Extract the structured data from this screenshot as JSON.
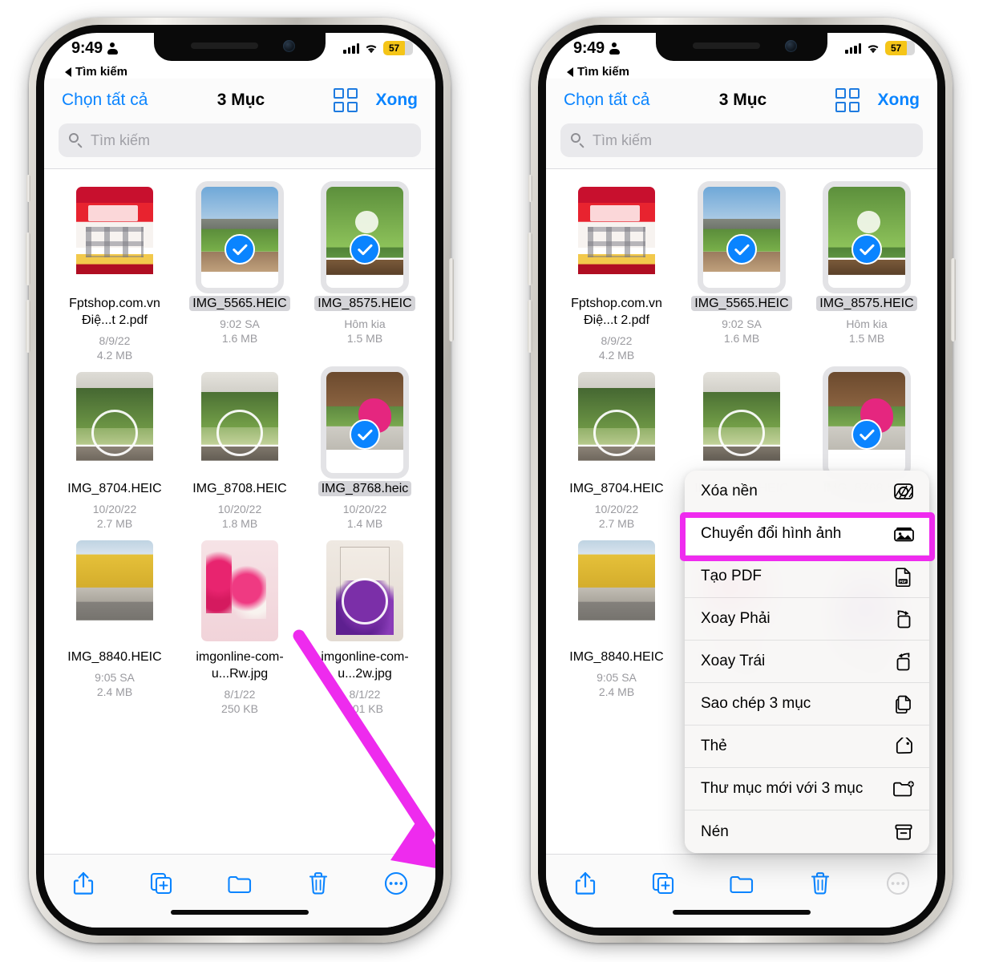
{
  "status_bar": {
    "time": "9:49",
    "battery_percent": "57",
    "back_label": "Tìm kiếm"
  },
  "nav": {
    "select_all": "Chọn tất cả",
    "title": "3 Mục",
    "done": "Xong"
  },
  "search": {
    "placeholder": "Tìm kiếm"
  },
  "files": [
    {
      "name": "Fptshop.com.vn  Điệ...t 2.pdf",
      "date": "8/9/22",
      "size": "4.2 MB",
      "selected": false,
      "art": "t-pdf",
      "focus_ring": false
    },
    {
      "name": "IMG_5565.HEIC",
      "date": "9:02 SA",
      "size": "1.6 MB",
      "selected": true,
      "art": "t-plant1",
      "focus_ring": false
    },
    {
      "name": "IMG_8575.HEIC",
      "date": "Hôm kia",
      "size": "1.5 MB",
      "selected": true,
      "art": "t-leaf",
      "focus_ring": false
    },
    {
      "name": "IMG_8704.HEIC",
      "date": "10/20/22",
      "size": "2.7 MB",
      "selected": false,
      "art": "t-garden",
      "focus_ring": true
    },
    {
      "name": "IMG_8708.HEIC",
      "date": "10/20/22",
      "size": "1.8 MB",
      "selected": false,
      "art": "t-garden2",
      "focus_ring": true
    },
    {
      "name": "IMG_8768.heic",
      "date": "10/20/22",
      "size": "1.4 MB",
      "selected": true,
      "art": "t-pink",
      "focus_ring": false
    },
    {
      "name": "IMG_8840.HEIC",
      "date": "9:05 SA",
      "size": "2.4 MB",
      "selected": false,
      "art": "t-street",
      "focus_ring": false
    },
    {
      "name": "imgonline-com-u...Rw.jpg",
      "date": "8/1/22",
      "size": "250 KB",
      "selected": false,
      "art": "t-rose",
      "focus_ring": false
    },
    {
      "name": "imgonline-com-u...2w.jpg",
      "date": "8/1/22",
      "size": "201 KB",
      "selected": false,
      "art": "t-purple",
      "focus_ring": true
    }
  ],
  "toolbar": {
    "share": "share-icon",
    "duplicate": "duplicate-icon",
    "folder": "folder-icon",
    "trash": "trash-icon",
    "more": "more-icon"
  },
  "context_menu": {
    "items": [
      {
        "label": "Xóa nền",
        "icon": "remove-background-icon"
      },
      {
        "label": "Chuyển đổi hình ảnh",
        "icon": "convert-image-icon"
      },
      {
        "label": "Tạo PDF",
        "icon": "create-pdf-icon"
      },
      {
        "label": "Xoay Phải",
        "icon": "rotate-right-icon"
      },
      {
        "label": "Xoay Trái",
        "icon": "rotate-left-icon"
      },
      {
        "label": "Sao chép 3 mục",
        "icon": "copy-icon"
      },
      {
        "label": "Thẻ",
        "icon": "tag-icon"
      },
      {
        "label": "Thư mục mới với 3 mục",
        "icon": "new-folder-icon"
      },
      {
        "label": "Nén",
        "icon": "compress-icon"
      }
    ],
    "highlighted_index": 1
  },
  "annotations": {
    "arrow_color": "#ee2bee",
    "highlight_color": "#ef2bef"
  }
}
